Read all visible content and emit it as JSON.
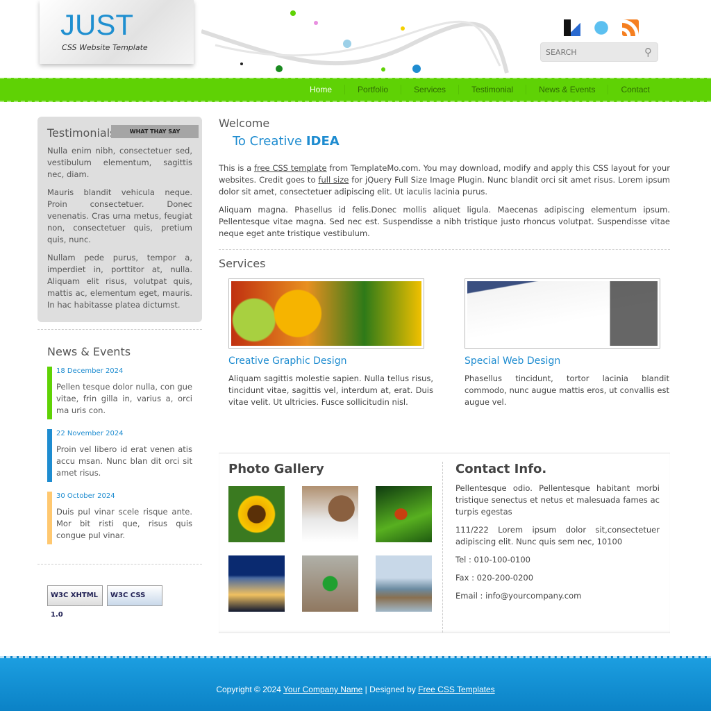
{
  "header": {
    "logo_title": "JUST",
    "logo_subtitle": "CSS Website Template",
    "search_placeholder": "SEARCH",
    "social": [
      "delicious-icon",
      "twitter-icon",
      "rss-icon"
    ]
  },
  "nav": {
    "items": [
      "Home",
      "Portfolio",
      "Services",
      "Testimonial",
      "News & Events",
      "Contact"
    ],
    "active": "Home"
  },
  "testimonials": {
    "title": "Testimonials",
    "tag": "WHAT THAY SAY",
    "paragraphs": [
      "Nulla enim nibh, consectetuer sed, vestibulum elementum, sagittis nec, diam.",
      "Mauris blandit vehicula neque. Proin consectetuer. Donec venenatis. Cras urna metus, feugiat non, consectetuer quis, pretium quis, nunc.",
      "Nullam pede purus, tempor a, imperdiet in, porttitor at, nulla. Aliquam elit risus, volutpat quis, mattis ac, elementum eget, mauris. In hac habitasse platea dictumst."
    ]
  },
  "news": {
    "title": "News & Events",
    "items": [
      {
        "date": "18 December 2024",
        "text": "Pellen tesque dolor nulla, con gue vitae, frin gilla in, varius a, orci ma uris con.",
        "color": "#5fd205"
      },
      {
        "date": "22 November 2024",
        "text": "Proin vel libero id erat venen atis accu msan. Nunc blan dit orci sit amet risus.",
        "color": "#1e8cd0"
      },
      {
        "date": "30 October 2024",
        "text": "Duis pul vinar scele risque ante. Mor bit risti que, risus quis congue pul vinar.",
        "color": "#ffc870"
      }
    ]
  },
  "badges": [
    "W3C XHTML 1.0",
    "W3C CSS"
  ],
  "welcome": {
    "title": "Welcome",
    "subtitle_pre": "To Creative ",
    "subtitle_bold": "IDEA",
    "p1_a": "This is a ",
    "p1_link1": "free CSS template",
    "p1_b": " from TemplateMo.com. You may download, modify and apply this CSS layout for your websites. Credit goes to ",
    "p1_link2": "full size",
    "p1_c": " for jQuery Full Size Image Plugin. Nunc blandit orci sit amet risus. Lorem ipsum dolor sit amet, consectetuer adipiscing elit. Ut iaculis lacinia purus.",
    "p2": "Aliquam magna. Phasellus id felis.Donec mollis aliquet ligula. Maecenas adipiscing elementum ipsum. Pellentesque vitae magna. Sed nec est. Suspendisse a nibh tristique justo rhoncus volutpat. Suspendisse vitae neque eget ante tristique vestibulum."
  },
  "services": {
    "title": "Services",
    "items": [
      {
        "title": "Creative Graphic Design",
        "text": "Aliquam sagittis molestie sapien. Nulla tellus risus, tincidunt vitae, sagittis vel, interdum at, erat. Duis vitae velit. Ut ultricies. Fusce sollicitudin nisl."
      },
      {
        "title": "Special Web Design",
        "text": "Phasellus tincidunt, tortor lacinia blandit commodo, nunc augue mattis eros, ut convallis est augue vel."
      }
    ]
  },
  "gallery": {
    "title": "Photo Gallery",
    "photos": [
      "sunflower",
      "stones",
      "ladybug",
      "city-night",
      "parrot",
      "pier"
    ]
  },
  "contact": {
    "title": "Contact Info.",
    "p1": "Pellentesque odio. Pellentesque habitant morbi tristique senectus et netus et malesuada fames ac turpis egestas",
    "p2": "111/222 Lorem ipsum dolor sit,consectetuer adipiscing elit. Nunc quis sem nec, 10100",
    "tel": "Tel : 010-100-0100",
    "fax": "Fax : 020-200-0200",
    "email": "Email : info@yourcompany.com"
  },
  "footer": {
    "pre": "Copyright © 2024 ",
    "company": "Your Company Name",
    "mid": " | Designed by ",
    "designer": "Free CSS Templates"
  }
}
